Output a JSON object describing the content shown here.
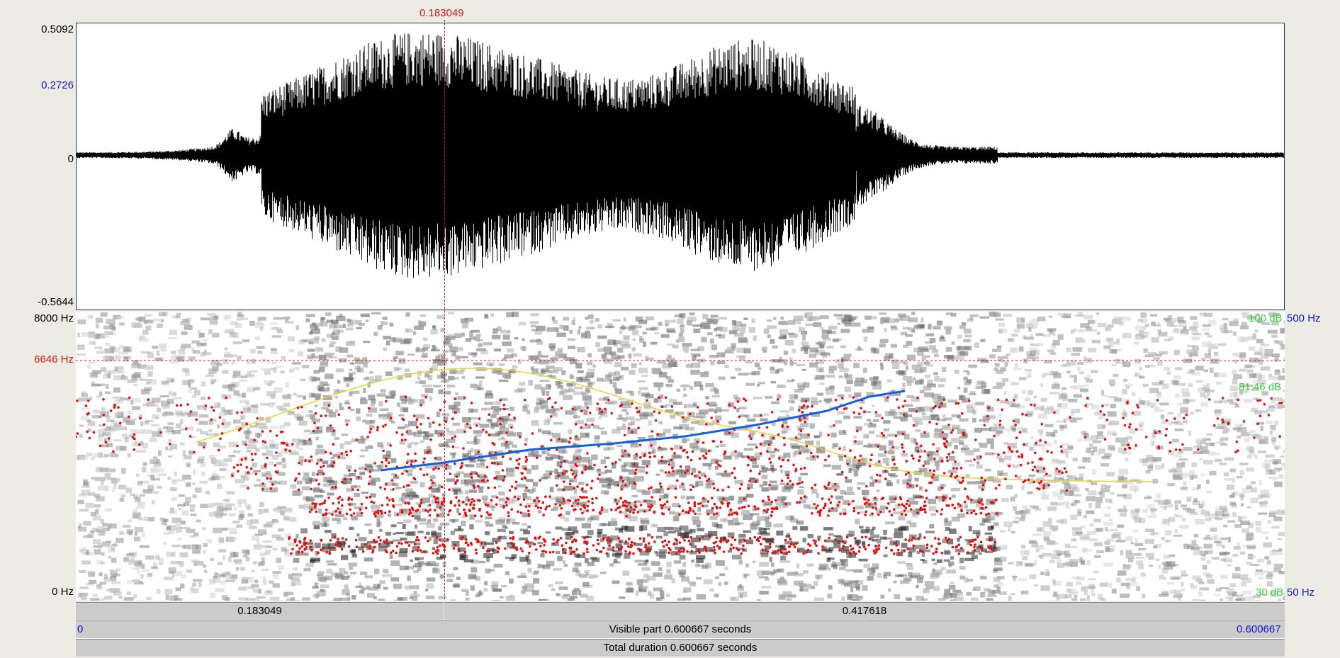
{
  "cursor": {
    "time_label": "0.183049",
    "time_fraction": 0.3048
  },
  "waveform": {
    "y_max_label": "0.5092",
    "y_mark_label": "0.2726",
    "y_zero_label": "0",
    "y_min_label": "-0.5644",
    "y_max": 0.5092,
    "y_mark": 0.2726,
    "y_min": -0.5644
  },
  "spectrogram": {
    "freq_top_label": "8000 Hz",
    "freq_cursor_label": "6646 Hz",
    "freq_bottom_label": "0 Hz",
    "freq_max": 8000,
    "freq_cursor": 6646,
    "intensity_top_label": "100 dB",
    "intensity_mark_label": "81.46 dB",
    "intensity_bottom_label": "30 dB",
    "pitch_top_label": "500 Hz",
    "pitch_bottom_label": "50 Hz"
  },
  "time_bars": {
    "left_segment_label": "0.183049",
    "right_segment_label": "0.417618",
    "visible_start_label": "0",
    "visible_label": "Visible part 0.600667 seconds",
    "visible_end_label": "0.600667",
    "total_label": "Total duration 0.600667 seconds"
  },
  "colors": {
    "cursor": "#d81818",
    "formant": "#e01010",
    "pitch": "#1460e0",
    "intensity": "#e6d23a",
    "waveform": "#000000"
  }
}
